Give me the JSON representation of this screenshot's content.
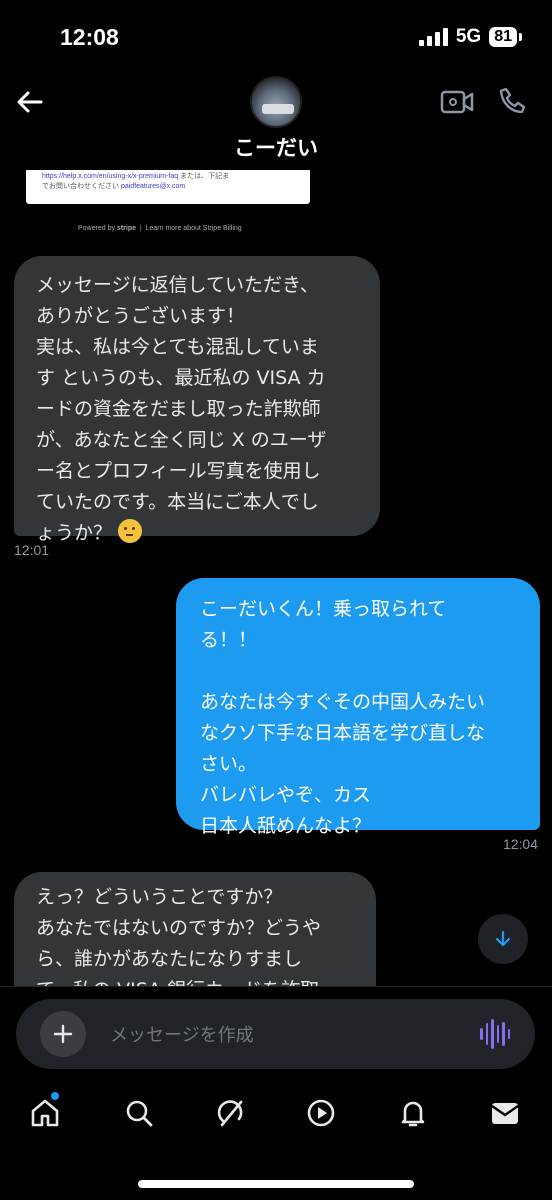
{
  "status": {
    "time": "12:08",
    "network": "5G",
    "battery": "81"
  },
  "header": {
    "name": "こーだい"
  },
  "invoice": {
    "link": "https://help.x.com/en/using-x/x-premium-faq",
    "line1_suffix": "または、下記ま",
    "line2": "でお問い合わせください",
    "email": "paidfeatures@x.com",
    "powered_prefix": "Powered by",
    "powered_brand": "stripe",
    "learn_more": "Learn more about Stripe Billing"
  },
  "messages": [
    {
      "direction": "in",
      "text": "メッセージに返信していただき、\nありがとうございます！\n実は、私は今とても混乱していま\nす というのも、最近私の VISA カ\nードの資金をだまし取った詐欺師\nが、あなたと全く同じ X のユーザ\nー名とプロフィール写真を使用し\nていたのです。本当にご本人でし\nょうか？",
      "time": "12:01"
    },
    {
      "direction": "out",
      "text": "こーだいくん！乗っ取られて\nる！！\n\nあなたは今すぐその中国人みたい\nなクソ下手な日本語を学び直しな\nさい。\nバレバレやぞ、カス\n日本人舐めんなよ？",
      "time": "12:04"
    },
    {
      "direction": "in",
      "text": "えっ？どういうことですか？\nあなたではないのですか？どうや\nら、誰かがあなたになりすまし\nて、私の VISA 銀行カードを詐取"
    }
  ],
  "composer": {
    "placeholder": "メッセージを作成"
  },
  "tabs": [
    "home",
    "search",
    "grok",
    "video",
    "notifications",
    "messages"
  ],
  "colors": {
    "accent": "#1d9bf0",
    "incoming_bubble": "#333639",
    "voice": "#8a6cf3"
  }
}
